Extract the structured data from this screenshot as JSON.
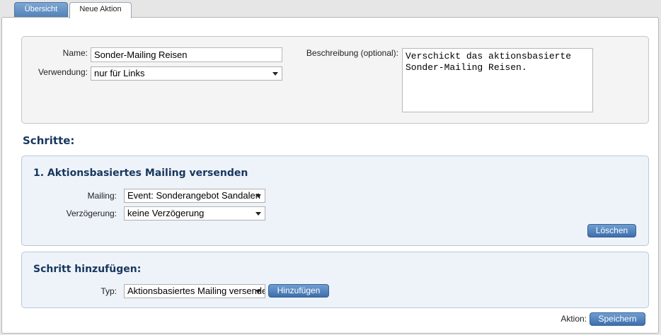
{
  "tabs": {
    "overview": "Übersicht",
    "new_action": "Neue Aktion"
  },
  "form": {
    "name_label": "Name:",
    "name_value": "Sonder-Mailing Reisen",
    "usage_label": "Verwendung:",
    "usage_value": "nur für Links",
    "description_label": "Beschreibung (optional):",
    "description_value": "Verschickt das aktionsbasierte\nSonder-Mailing Reisen."
  },
  "steps": {
    "heading": "Schritte:",
    "items": [
      {
        "title": "1. Aktionsbasiertes Mailing versenden",
        "mailing_label": "Mailing:",
        "mailing_value": "Event: Sonderangebot Sandalen",
        "delay_label": "Verzögerung:",
        "delay_value": "keine Verzögerung",
        "delete_label": "Löschen"
      }
    ]
  },
  "add_step": {
    "heading": "Schritt hinzufügen:",
    "type_label": "Typ:",
    "type_value": "Aktionsbasiertes Mailing versenden",
    "add_label": "Hinzufügen"
  },
  "footer": {
    "action_label": "Aktion:",
    "save_label": "Speichern"
  },
  "colors": {
    "accent": "#3e6fac",
    "heading": "#17375e",
    "panel_blue": "#eef3fa",
    "panel_gray": "#f4f4f4"
  },
  "icons": {
    "dropdown": "chevron-down-icon"
  }
}
